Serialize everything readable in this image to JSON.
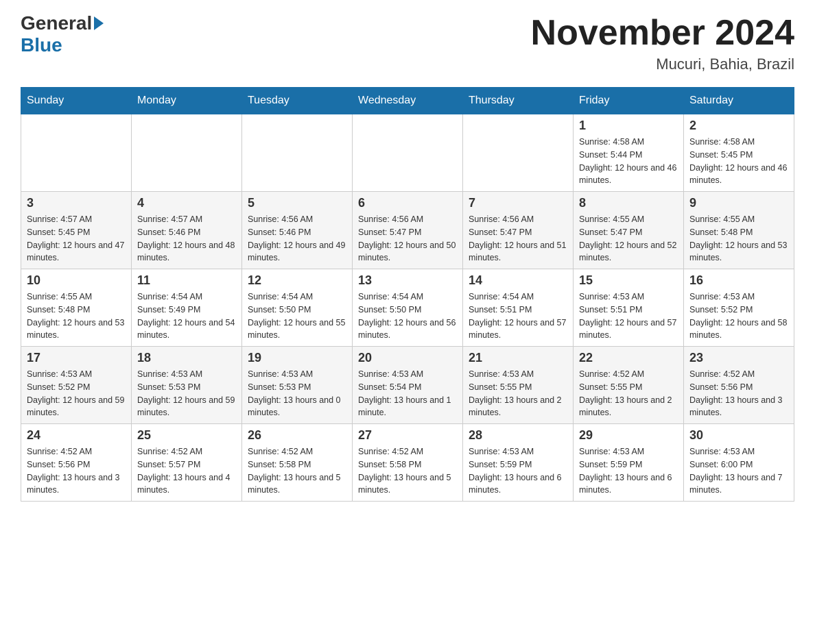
{
  "header": {
    "logo_general": "General",
    "logo_blue": "Blue",
    "month_title": "November 2024",
    "location": "Mucuri, Bahia, Brazil"
  },
  "weekdays": [
    "Sunday",
    "Monday",
    "Tuesday",
    "Wednesday",
    "Thursday",
    "Friday",
    "Saturday"
  ],
  "rows": [
    [
      {
        "day": "",
        "info": ""
      },
      {
        "day": "",
        "info": ""
      },
      {
        "day": "",
        "info": ""
      },
      {
        "day": "",
        "info": ""
      },
      {
        "day": "",
        "info": ""
      },
      {
        "day": "1",
        "info": "Sunrise: 4:58 AM\nSunset: 5:44 PM\nDaylight: 12 hours and 46 minutes."
      },
      {
        "day": "2",
        "info": "Sunrise: 4:58 AM\nSunset: 5:45 PM\nDaylight: 12 hours and 46 minutes."
      }
    ],
    [
      {
        "day": "3",
        "info": "Sunrise: 4:57 AM\nSunset: 5:45 PM\nDaylight: 12 hours and 47 minutes."
      },
      {
        "day": "4",
        "info": "Sunrise: 4:57 AM\nSunset: 5:46 PM\nDaylight: 12 hours and 48 minutes."
      },
      {
        "day": "5",
        "info": "Sunrise: 4:56 AM\nSunset: 5:46 PM\nDaylight: 12 hours and 49 minutes."
      },
      {
        "day": "6",
        "info": "Sunrise: 4:56 AM\nSunset: 5:47 PM\nDaylight: 12 hours and 50 minutes."
      },
      {
        "day": "7",
        "info": "Sunrise: 4:56 AM\nSunset: 5:47 PM\nDaylight: 12 hours and 51 minutes."
      },
      {
        "day": "8",
        "info": "Sunrise: 4:55 AM\nSunset: 5:47 PM\nDaylight: 12 hours and 52 minutes."
      },
      {
        "day": "9",
        "info": "Sunrise: 4:55 AM\nSunset: 5:48 PM\nDaylight: 12 hours and 53 minutes."
      }
    ],
    [
      {
        "day": "10",
        "info": "Sunrise: 4:55 AM\nSunset: 5:48 PM\nDaylight: 12 hours and 53 minutes."
      },
      {
        "day": "11",
        "info": "Sunrise: 4:54 AM\nSunset: 5:49 PM\nDaylight: 12 hours and 54 minutes."
      },
      {
        "day": "12",
        "info": "Sunrise: 4:54 AM\nSunset: 5:50 PM\nDaylight: 12 hours and 55 minutes."
      },
      {
        "day": "13",
        "info": "Sunrise: 4:54 AM\nSunset: 5:50 PM\nDaylight: 12 hours and 56 minutes."
      },
      {
        "day": "14",
        "info": "Sunrise: 4:54 AM\nSunset: 5:51 PM\nDaylight: 12 hours and 57 minutes."
      },
      {
        "day": "15",
        "info": "Sunrise: 4:53 AM\nSunset: 5:51 PM\nDaylight: 12 hours and 57 minutes."
      },
      {
        "day": "16",
        "info": "Sunrise: 4:53 AM\nSunset: 5:52 PM\nDaylight: 12 hours and 58 minutes."
      }
    ],
    [
      {
        "day": "17",
        "info": "Sunrise: 4:53 AM\nSunset: 5:52 PM\nDaylight: 12 hours and 59 minutes."
      },
      {
        "day": "18",
        "info": "Sunrise: 4:53 AM\nSunset: 5:53 PM\nDaylight: 12 hours and 59 minutes."
      },
      {
        "day": "19",
        "info": "Sunrise: 4:53 AM\nSunset: 5:53 PM\nDaylight: 13 hours and 0 minutes."
      },
      {
        "day": "20",
        "info": "Sunrise: 4:53 AM\nSunset: 5:54 PM\nDaylight: 13 hours and 1 minute."
      },
      {
        "day": "21",
        "info": "Sunrise: 4:53 AM\nSunset: 5:55 PM\nDaylight: 13 hours and 2 minutes."
      },
      {
        "day": "22",
        "info": "Sunrise: 4:52 AM\nSunset: 5:55 PM\nDaylight: 13 hours and 2 minutes."
      },
      {
        "day": "23",
        "info": "Sunrise: 4:52 AM\nSunset: 5:56 PM\nDaylight: 13 hours and 3 minutes."
      }
    ],
    [
      {
        "day": "24",
        "info": "Sunrise: 4:52 AM\nSunset: 5:56 PM\nDaylight: 13 hours and 3 minutes."
      },
      {
        "day": "25",
        "info": "Sunrise: 4:52 AM\nSunset: 5:57 PM\nDaylight: 13 hours and 4 minutes."
      },
      {
        "day": "26",
        "info": "Sunrise: 4:52 AM\nSunset: 5:58 PM\nDaylight: 13 hours and 5 minutes."
      },
      {
        "day": "27",
        "info": "Sunrise: 4:52 AM\nSunset: 5:58 PM\nDaylight: 13 hours and 5 minutes."
      },
      {
        "day": "28",
        "info": "Sunrise: 4:53 AM\nSunset: 5:59 PM\nDaylight: 13 hours and 6 minutes."
      },
      {
        "day": "29",
        "info": "Sunrise: 4:53 AM\nSunset: 5:59 PM\nDaylight: 13 hours and 6 minutes."
      },
      {
        "day": "30",
        "info": "Sunrise: 4:53 AM\nSunset: 6:00 PM\nDaylight: 13 hours and 7 minutes."
      }
    ]
  ]
}
